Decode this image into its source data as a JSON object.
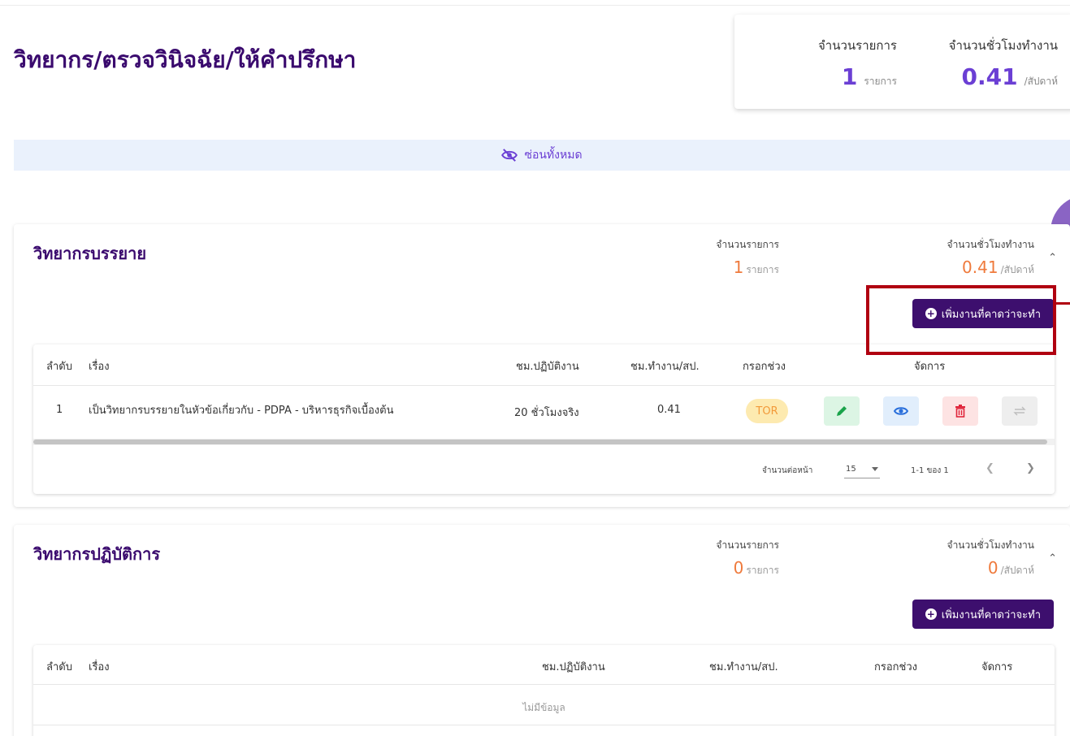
{
  "page": {
    "title": "วิทยากร/ตรวจวินิจฉัย/ให้คำปรึกษา"
  },
  "summary": {
    "count_label": "จำนวนรายการ",
    "count_value": "1",
    "count_unit": "รายการ",
    "hours_label": "จำนวนชั่วโมงทำงาน",
    "hours_value": "0.41",
    "hours_unit": "/สัปดาห์"
  },
  "hide_all": {
    "label": "ซ่อนทั้งหมด",
    "icon": "eye-off-icon"
  },
  "sections": [
    {
      "title": "วิทยากรบรรยาย",
      "count_label": "จำนวนรายการ",
      "count_value": "1",
      "count_unit": "รายการ",
      "hours_label": "จำนวนชั่วโมงทำงาน",
      "hours_value": "0.41",
      "hours_unit": "/สัปดาห์",
      "add_label": "เพิ่มงานที่คาดว่าจะทำ",
      "columns": [
        "ลำดับ",
        "เรื่อง",
        "ชม.ปฏิบัติงาน",
        "ชม.ทำงาน/สป.",
        "กรอกช่วง",
        "จัดการ"
      ],
      "rows": [
        {
          "index": "1",
          "subject": "เป็นวิทยากรบรรยายในหัวข้อเกี่ยวกับ - PDPA - บริหารธุรกิจเบื้องต้น",
          "work_hours": "20 ชั่วโมงจริง",
          "hours_per_week": "0.41",
          "period": "TOR"
        }
      ],
      "pager": {
        "per_page_label": "จำนวนต่อหน้า",
        "per_page": "15",
        "range": "1-1 ของ 1"
      }
    },
    {
      "title": "วิทยากรปฏิบัติการ",
      "count_label": "จำนวนรายการ",
      "count_value": "0",
      "count_unit": "รายการ",
      "hours_label": "จำนวนชั่วโมงทำงาน",
      "hours_value": "0",
      "hours_unit": "/สัปดาห์",
      "add_label": "เพิ่มงานที่คาดว่าจะทำ",
      "columns": [
        "ลำดับ",
        "เรื่อง",
        "ชม.ปฏิบัติงาน",
        "ชม.ทำงาน/สป.",
        "กรอกช่วง",
        "จัดการ"
      ],
      "empty_text": "ไม่มีข้อมูล"
    }
  ],
  "colors": {
    "brand": "#3a0a6e",
    "accent": "#6b3fd4",
    "stat_orange": "#ef7a3c",
    "highlight": "#b00010"
  }
}
